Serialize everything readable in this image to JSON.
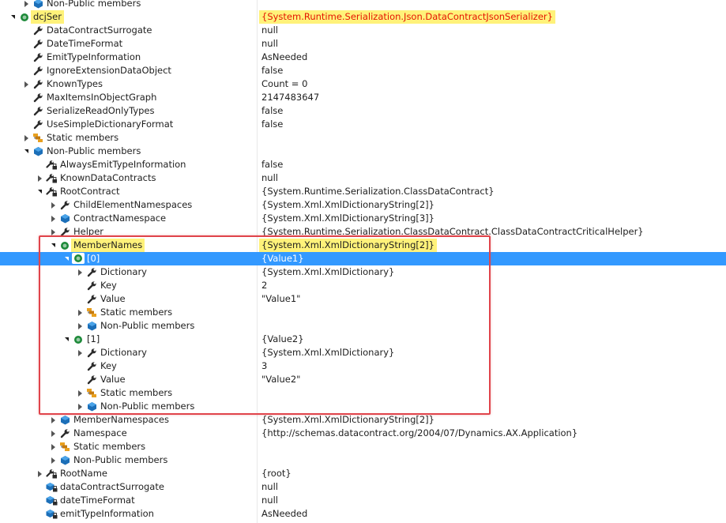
{
  "accent": "#3399ff",
  "highlight_color": "#fff27a",
  "callout_color": "#e0444b",
  "rows": [
    {
      "name": "Non-Public members",
      "value": "",
      "level": 1,
      "toggle": "collapsed",
      "icon": "nonpublic-members-icon"
    },
    {
      "name": "dcjSer",
      "value": "{System.Runtime.Serialization.Json.DataContractJsonSerializer}",
      "level": 0,
      "toggle": "expanded",
      "icon": "object-icon",
      "highlight": true,
      "value_red": true
    },
    {
      "name": "DataContractSurrogate",
      "value": "null",
      "level": 1,
      "toggle": "",
      "icon": "property-wrench-icon"
    },
    {
      "name": "DateTimeFormat",
      "value": "null",
      "level": 1,
      "toggle": "",
      "icon": "property-wrench-icon"
    },
    {
      "name": "EmitTypeInformation",
      "value": "AsNeeded",
      "level": 1,
      "toggle": "",
      "icon": "property-wrench-icon"
    },
    {
      "name": "IgnoreExtensionDataObject",
      "value": "false",
      "level": 1,
      "toggle": "",
      "icon": "property-wrench-icon"
    },
    {
      "name": "KnownTypes",
      "value": "Count = 0",
      "level": 1,
      "toggle": "collapsed",
      "icon": "property-wrench-icon"
    },
    {
      "name": "MaxItemsInObjectGraph",
      "value": "2147483647",
      "level": 1,
      "toggle": "",
      "icon": "property-wrench-icon"
    },
    {
      "name": "SerializeReadOnlyTypes",
      "value": "false",
      "level": 1,
      "toggle": "",
      "icon": "property-wrench-icon"
    },
    {
      "name": "UseSimpleDictionaryFormat",
      "value": "false",
      "level": 1,
      "toggle": "",
      "icon": "property-wrench-icon"
    },
    {
      "name": "Static members",
      "value": "",
      "level": 1,
      "toggle": "collapsed",
      "icon": "static-members-icon"
    },
    {
      "name": "Non-Public members",
      "value": "",
      "level": 1,
      "toggle": "expanded",
      "icon": "nonpublic-members-icon"
    },
    {
      "name": "AlwaysEmitTypeInformation",
      "value": "false",
      "level": 2,
      "toggle": "",
      "icon": "private-property-icon"
    },
    {
      "name": "KnownDataContracts",
      "value": "null",
      "level": 2,
      "toggle": "collapsed",
      "icon": "private-property-icon"
    },
    {
      "name": "RootContract",
      "value": "{System.Runtime.Serialization.ClassDataContract}",
      "level": 2,
      "toggle": "expanded",
      "icon": "private-property-icon"
    },
    {
      "name": "ChildElementNamespaces",
      "value": "{System.Xml.XmlDictionaryString[2]}",
      "level": 3,
      "toggle": "collapsed",
      "icon": "property-wrench-icon"
    },
    {
      "name": "ContractNamespace",
      "value": "{System.Xml.XmlDictionaryString[3]}",
      "level": 3,
      "toggle": "collapsed",
      "icon": "field-icon"
    },
    {
      "name": "Helper",
      "value": "{System.Runtime.Serialization.ClassDataContract.ClassDataContractCriticalHelper}",
      "level": 3,
      "toggle": "collapsed",
      "icon": "property-wrench-icon"
    },
    {
      "name": "MemberNames",
      "value": "{System.Xml.XmlDictionaryString[2]}",
      "level": 3,
      "toggle": "expanded",
      "icon": "object-icon",
      "highlight": true
    },
    {
      "name": "[0]",
      "value": "{Value1}",
      "level": 4,
      "toggle": "expanded",
      "icon": "object-icon",
      "selected": true
    },
    {
      "name": "Dictionary",
      "value": "{System.Xml.XmlDictionary}",
      "level": 5,
      "toggle": "collapsed",
      "icon": "property-wrench-icon"
    },
    {
      "name": "Key",
      "value": "2",
      "level": 5,
      "toggle": "",
      "icon": "property-wrench-icon"
    },
    {
      "name": "Value",
      "value": "\"Value1\"",
      "level": 5,
      "toggle": "",
      "icon": "property-wrench-icon"
    },
    {
      "name": "Static members",
      "value": "",
      "level": 5,
      "toggle": "collapsed",
      "icon": "static-members-icon"
    },
    {
      "name": "Non-Public members",
      "value": "",
      "level": 5,
      "toggle": "collapsed",
      "icon": "nonpublic-members-icon"
    },
    {
      "name": "[1]",
      "value": "{Value2}",
      "level": 4,
      "toggle": "expanded",
      "icon": "object-icon"
    },
    {
      "name": "Dictionary",
      "value": "{System.Xml.XmlDictionary}",
      "level": 5,
      "toggle": "collapsed",
      "icon": "property-wrench-icon"
    },
    {
      "name": "Key",
      "value": "3",
      "level": 5,
      "toggle": "",
      "icon": "property-wrench-icon"
    },
    {
      "name": "Value",
      "value": "\"Value2\"",
      "level": 5,
      "toggle": "",
      "icon": "property-wrench-icon"
    },
    {
      "name": "Static members",
      "value": "",
      "level": 5,
      "toggle": "collapsed",
      "icon": "static-members-icon"
    },
    {
      "name": "Non-Public members",
      "value": "",
      "level": 5,
      "toggle": "collapsed",
      "icon": "nonpublic-members-icon"
    },
    {
      "name": "MemberNamespaces",
      "value": "{System.Xml.XmlDictionaryString[2]}",
      "level": 3,
      "toggle": "collapsed",
      "icon": "field-icon"
    },
    {
      "name": "Namespace",
      "value": "{http://schemas.datacontract.org/2004/07/Dynamics.AX.Application}",
      "level": 3,
      "toggle": "collapsed",
      "icon": "property-wrench-icon"
    },
    {
      "name": "Static members",
      "value": "",
      "level": 3,
      "toggle": "collapsed",
      "icon": "static-members-icon"
    },
    {
      "name": "Non-Public members",
      "value": "",
      "level": 3,
      "toggle": "collapsed",
      "icon": "nonpublic-members-icon"
    },
    {
      "name": "RootName",
      "value": "{root}",
      "level": 2,
      "toggle": "collapsed",
      "icon": "private-property-icon"
    },
    {
      "name": "dataContractSurrogate",
      "value": "null",
      "level": 2,
      "toggle": "",
      "icon": "private-field-icon"
    },
    {
      "name": "dateTimeFormat",
      "value": "null",
      "level": 2,
      "toggle": "",
      "icon": "private-field-icon"
    },
    {
      "name": "emitTypeInformation",
      "value": "AsNeeded",
      "level": 2,
      "toggle": "",
      "icon": "private-field-icon"
    }
  ]
}
